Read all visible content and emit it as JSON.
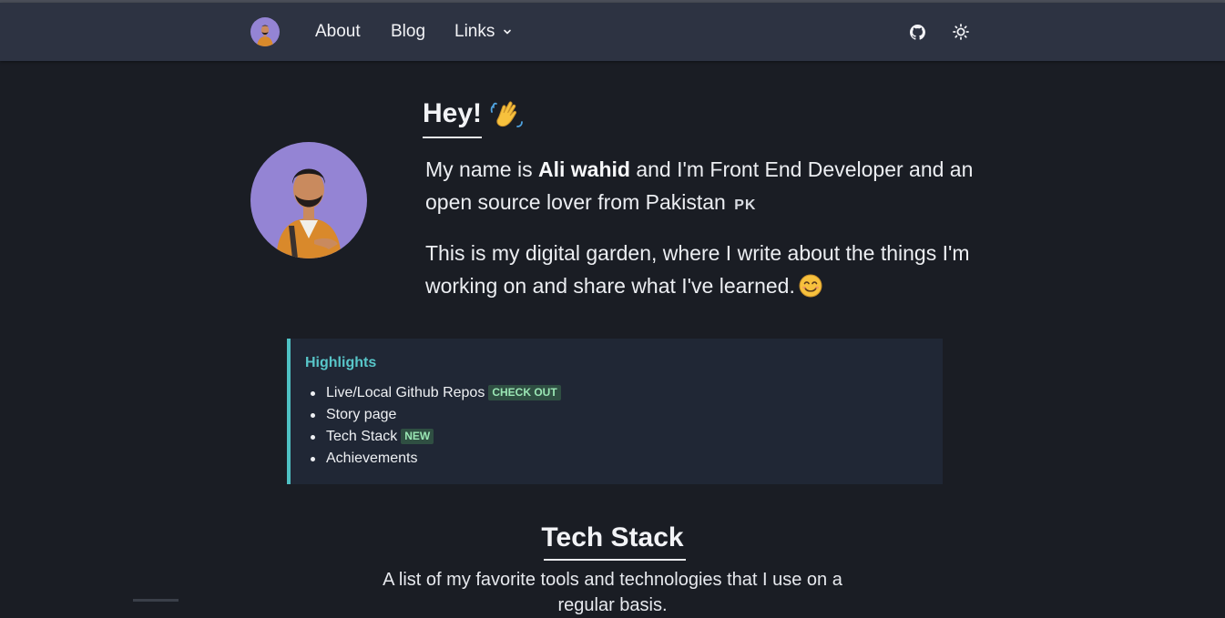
{
  "nav": {
    "about": "About",
    "blog": "Blog",
    "links": "Links",
    "icons": [
      "avatar",
      "github-icon",
      "sun-icon",
      "chevron-down-icon"
    ]
  },
  "hero": {
    "greeting": "Hey!",
    "wave_icon": "waving-hand-emoji",
    "intro_prefix": "My name is ",
    "name": "Ali wahid",
    "intro_suffix": " and I'm Front End Developer and an open source lover from Pakistan ",
    "flag": "PK",
    "garden": "This is my digital garden, where I write about the things I'm working on and share what I've learned.",
    "smile_icon": "smiling-face-emoji"
  },
  "highlights": {
    "title": "Highlights",
    "items": [
      {
        "label": "Live/Local Github Repos",
        "badge": "CHECK OUT"
      },
      {
        "label": "Story page",
        "badge": ""
      },
      {
        "label": "Tech Stack",
        "badge": "NEW"
      },
      {
        "label": "Achievements",
        "badge": ""
      }
    ]
  },
  "techstack": {
    "title": "Tech Stack",
    "description": "A list of my favorite tools and technologies that I use on a regular basis."
  },
  "colors": {
    "background": "#1a1d24",
    "navbar": "#2d3342",
    "accent": "#4fc1c4",
    "badge_bg": "#2f4f42",
    "badge_text": "#9ae6b4",
    "avatar_bg": "#9484d4"
  }
}
